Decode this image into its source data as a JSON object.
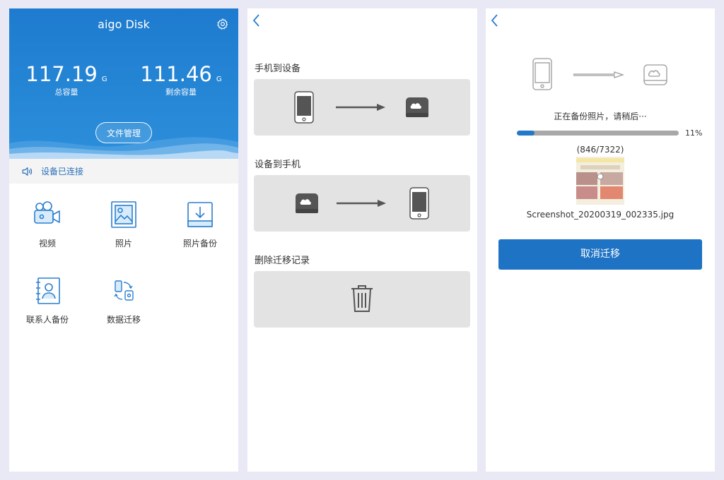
{
  "home": {
    "title": "aigo Disk",
    "total": {
      "value": "117.19",
      "unit": "G",
      "label": "总容量"
    },
    "free": {
      "value": "111.46",
      "unit": "G",
      "label": "剩余容量"
    },
    "file_button": "文件管理",
    "status": "设备已连接",
    "functions": [
      {
        "label": "视频",
        "icon": "video-camera-icon"
      },
      {
        "label": "照片",
        "icon": "photo-icon"
      },
      {
        "label": "照片备份",
        "icon": "download-tray-icon"
      },
      {
        "label": "联系人备份",
        "icon": "contact-card-icon"
      },
      {
        "label": "数据迁移",
        "icon": "data-transfer-icon"
      }
    ],
    "colors": {
      "primary": "#1e7bcf",
      "status_text": "#2a6fb8"
    }
  },
  "migrate": {
    "sections": [
      {
        "title": "手机到设备"
      },
      {
        "title": "设备到手机"
      },
      {
        "title": "删除迁移记录"
      }
    ]
  },
  "progress": {
    "status_text": "正在备份照片，请稍后···",
    "percent_label": "11%",
    "fraction": 0.11,
    "count": "(846/7322)",
    "filename": "Screenshot_20200319_002335.jpg",
    "cancel_button": "取消迁移",
    "colors": {
      "bar": "#2279c8",
      "track": "#a8a8a8"
    }
  }
}
